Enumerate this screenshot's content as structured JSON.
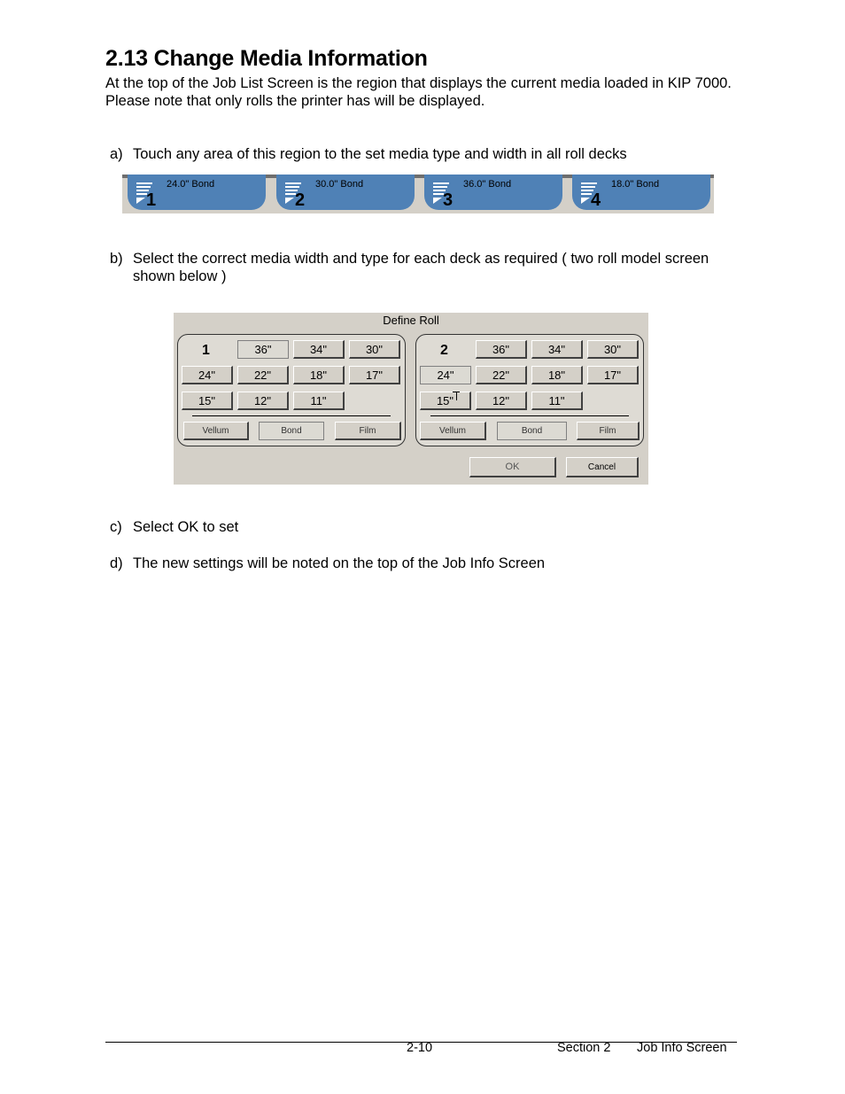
{
  "heading": "2.13  Change Media Information",
  "intro": "At the top of the Job List Screen is the region that displays the current media loaded in KIP 7000. Please note that only rolls the printer has will be displayed.",
  "steps": [
    {
      "label": "a)",
      "text": "Touch any area of this region to the set media type and width in all roll decks"
    },
    {
      "label": "b)",
      "text": "Select the correct media width and type for each deck as required ( two roll model screen shown below )"
    },
    {
      "label": "c)",
      "text": "Select OK to set"
    },
    {
      "label": "d)",
      "text": "The new settings will be noted on the top of the Job Info Screen"
    }
  ],
  "roll_bar": {
    "accent": "#4f81b6",
    "rolls": [
      {
        "number": "1",
        "media": "24.0\" Bond",
        "icon": "roll-icon"
      },
      {
        "number": "2",
        "media": "30.0\" Bond",
        "icon": "roll-icon"
      },
      {
        "number": "3",
        "media": "36.0\" Bond",
        "icon": "roll-icon"
      },
      {
        "number": "4",
        "media": "18.0\" Bond",
        "icon": "roll-icon"
      }
    ]
  },
  "define_roll": {
    "title": "Define Roll",
    "decks": [
      {
        "number": "1",
        "widths": [
          "36\"",
          "34\"",
          "30\"",
          "24\"",
          "22\"",
          "18\"",
          "17\"",
          "15\"",
          "12\"",
          "11\""
        ],
        "selected_width": "36\"",
        "types": [
          "Vellum",
          "Bond",
          "Film"
        ],
        "selected_type": "Bond"
      },
      {
        "number": "2",
        "widths": [
          "36\"",
          "34\"",
          "30\"",
          "24\"",
          "22\"",
          "18\"",
          "17\"",
          "15\"",
          "12\"",
          "11\""
        ],
        "selected_width": "24\"",
        "types": [
          "Vellum",
          "Bond",
          "Film"
        ],
        "selected_type": "Bond"
      }
    ],
    "ok_label": "OK",
    "cancel_label": "Cancel"
  },
  "footer": {
    "page": "2-10",
    "section": "Section 2",
    "chapter": "Job Info Screen"
  }
}
